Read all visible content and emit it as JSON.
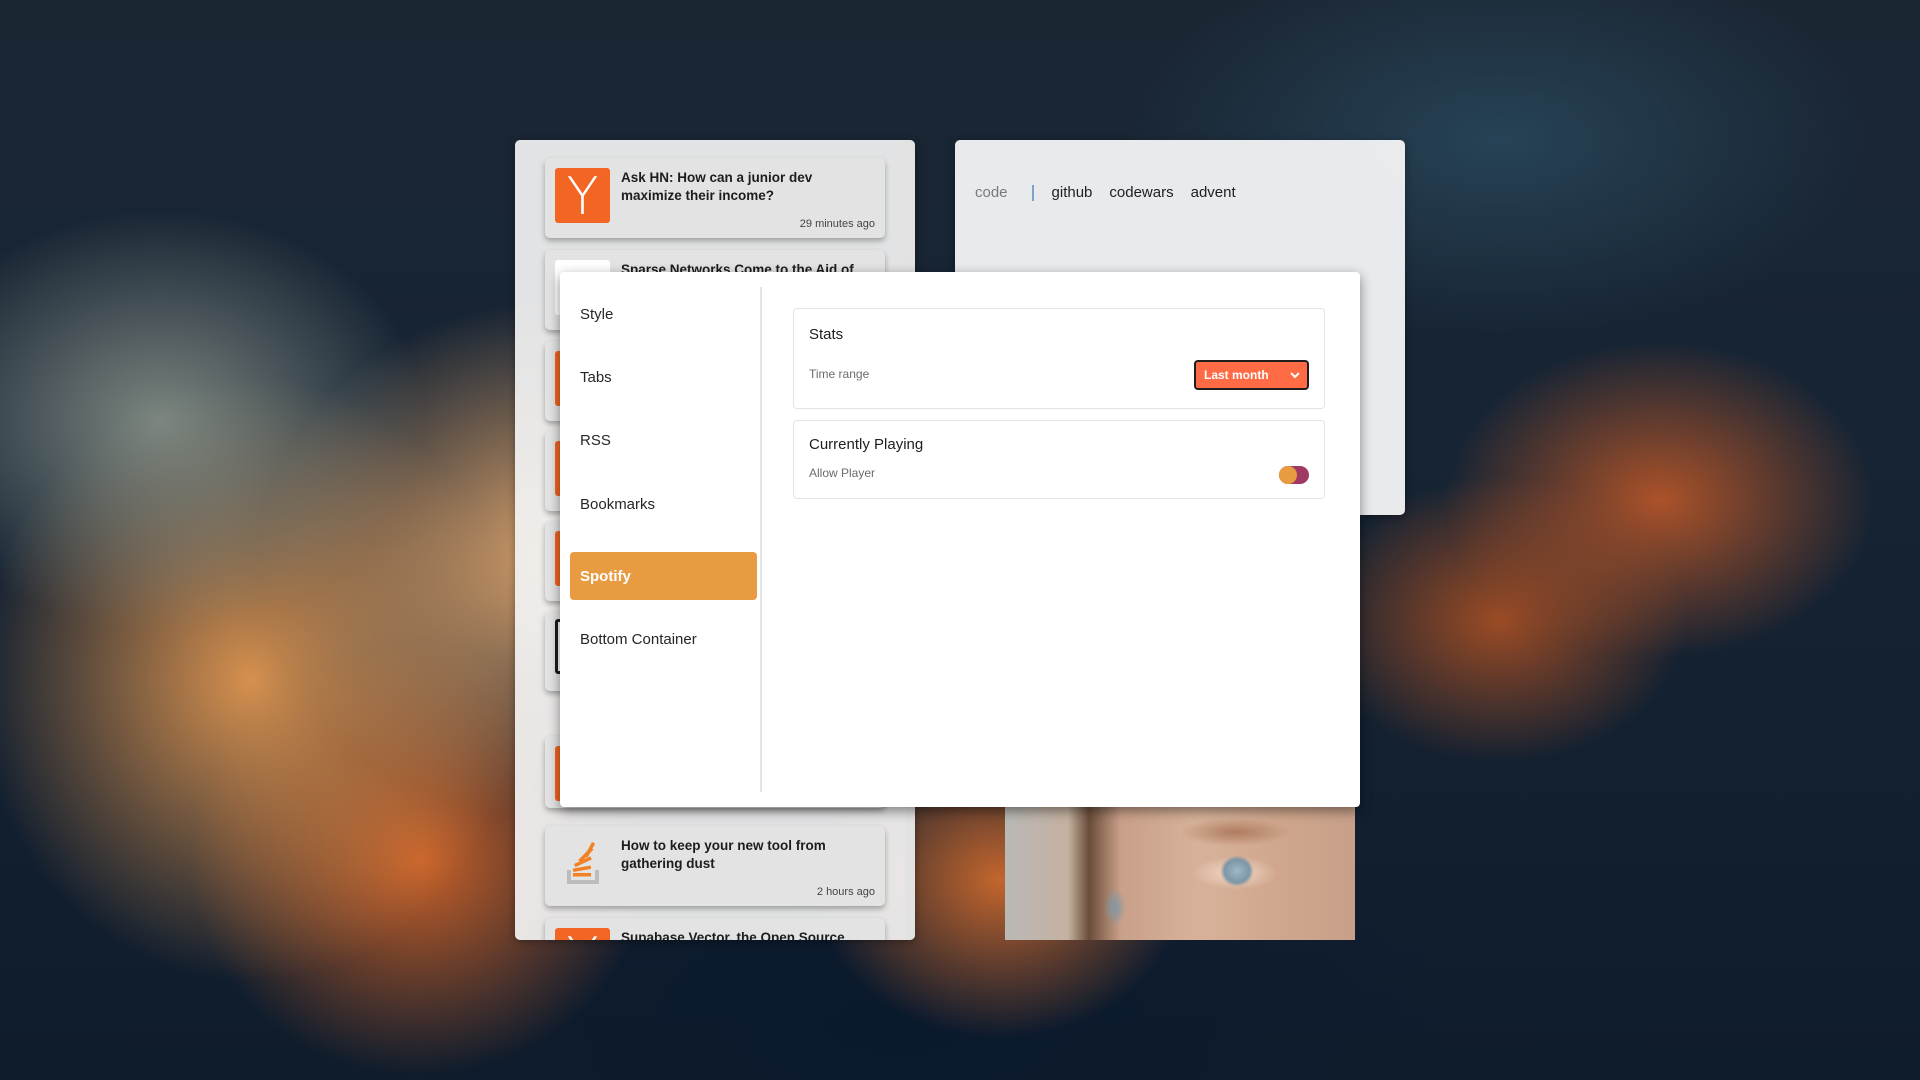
{
  "feed": {
    "items": [
      {
        "source": "hacker-news",
        "icon_glyph": "Y",
        "title": "Ask HN: How can a junior dev maximize their income?",
        "time": "29 minutes ago"
      },
      {
        "source": "generic",
        "icon_glyph": "",
        "title": "Sparse Networks Come to the Aid of",
        "time": ""
      },
      {
        "source": "hacker-news",
        "icon_glyph": "",
        "title": "",
        "time": ""
      },
      {
        "source": "hacker-news",
        "icon_glyph": "",
        "title": "",
        "time": ""
      },
      {
        "source": "hacker-news",
        "icon_glyph": "",
        "title": "",
        "time": ""
      },
      {
        "source": "outlined",
        "icon_glyph": "",
        "title": "",
        "time": ""
      },
      {
        "source": "hacker-news",
        "icon_glyph": "",
        "title": "",
        "time": ""
      },
      {
        "source": "stack-overflow",
        "icon_glyph": "",
        "title": "How to keep your new tool from gathering dust",
        "time": "2 hours ago"
      },
      {
        "source": "hacker-news",
        "icon_glyph": "Y",
        "title": "Supabase Vector, the Open Source",
        "time": ""
      }
    ]
  },
  "links": {
    "category": "code",
    "items": [
      "github",
      "codewars",
      "advent"
    ]
  },
  "settings": {
    "sidebar": [
      {
        "label": "Style",
        "active": false
      },
      {
        "label": "Tabs",
        "active": false
      },
      {
        "label": "RSS",
        "active": false
      },
      {
        "label": "Bookmarks",
        "active": false
      },
      {
        "label": "Spotify",
        "active": true
      },
      {
        "label": "Bottom Container",
        "active": false
      }
    ],
    "stats": {
      "title": "Stats",
      "time_range_label": "Time range",
      "time_range_value": "Last month"
    },
    "currently_playing": {
      "title": "Currently Playing",
      "allow_player_label": "Allow Player",
      "allow_player_enabled": true
    }
  },
  "colors": {
    "accent": "#e89b40",
    "select_bg": "#ff6b45",
    "toggle_track": "#a03a64",
    "hn_orange": "#f26522"
  }
}
